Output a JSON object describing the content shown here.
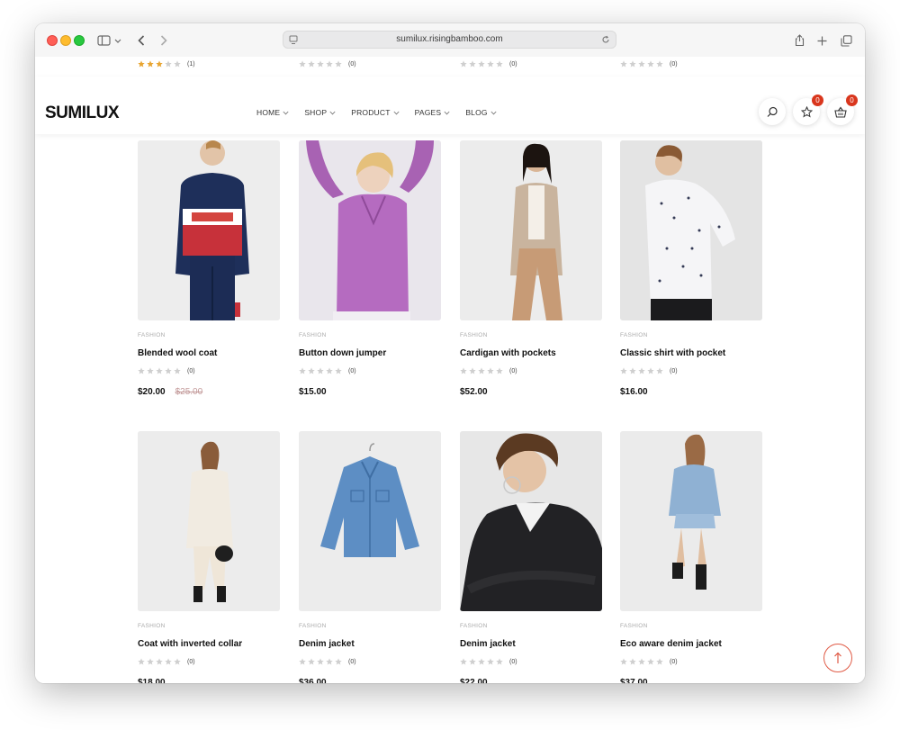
{
  "browser": {
    "url": "sumilux.risingbamboo.com",
    "sidebar_icon": "sidebar-icon",
    "back_icon": "chevron-left-icon",
    "forward_icon": "chevron-right-icon",
    "share_icon": "share-icon",
    "newtab_icon": "plus-icon",
    "tabs_icon": "tabs-overview-icon"
  },
  "header": {
    "logo": "SUMILUX",
    "nav": [
      "HOME",
      "SHOP",
      "PRODUCT",
      "PAGES",
      "BLOG"
    ],
    "wishlist_count": "0",
    "cart_count": "0"
  },
  "partial_row": [
    {
      "rating_count": "(1)",
      "stars": 3
    },
    {
      "rating_count": "(0)",
      "stars": 0
    },
    {
      "rating_count": "(0)",
      "stars": 0
    },
    {
      "rating_count": "(0)",
      "stars": 0
    }
  ],
  "products": [
    {
      "category": "FASHION",
      "name": "Blended wool coat",
      "rating_count": "(0)",
      "price": "$20.00",
      "old_price": "$25.00"
    },
    {
      "category": "FASHION",
      "name": "Button down jumper",
      "rating_count": "(0)",
      "price": "$15.00",
      "old_price": ""
    },
    {
      "category": "FASHION",
      "name": "Cardigan with pockets",
      "rating_count": "(0)",
      "price": "$52.00",
      "old_price": ""
    },
    {
      "category": "FASHION",
      "name": "Classic shirt with pocket",
      "rating_count": "(0)",
      "price": "$16.00",
      "old_price": ""
    },
    {
      "category": "FASHION",
      "name": "Coat with inverted collar",
      "rating_count": "(0)",
      "price": "$18.00",
      "old_price": ""
    },
    {
      "category": "FASHION",
      "name": "Denim jacket",
      "rating_count": "(0)",
      "price": "$36.00",
      "old_price": ""
    },
    {
      "category": "FASHION",
      "name": "Denim jacket",
      "rating_count": "(0)",
      "price": "$22.00",
      "old_price": ""
    },
    {
      "category": "FASHION",
      "name": "Eco aware denim jacket",
      "rating_count": "(0)",
      "price": "$37.00",
      "old_price": ""
    }
  ],
  "colors": {
    "accent": "#d9361d",
    "star_filled": "#e8a531",
    "star_empty": "#cfcfcf"
  }
}
